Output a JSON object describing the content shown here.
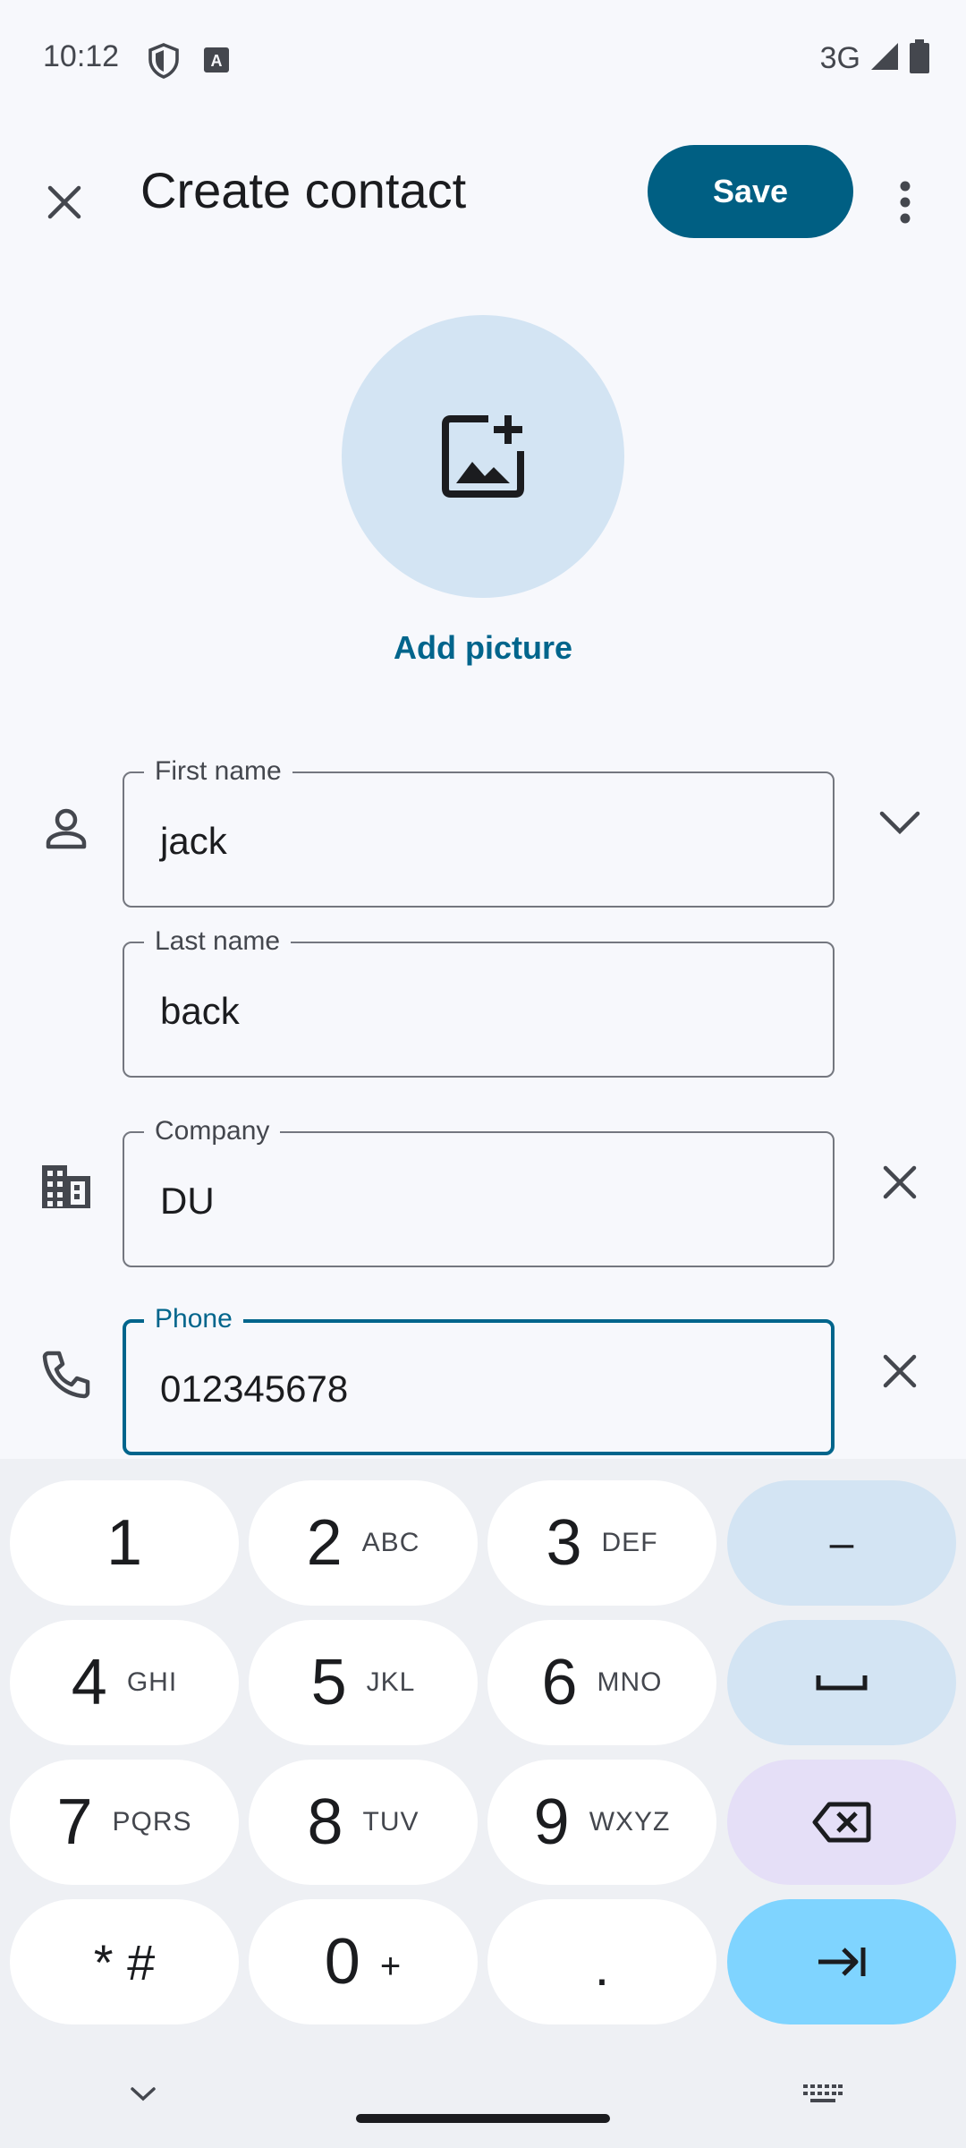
{
  "status_bar": {
    "time": "10:12",
    "network": "3G",
    "icons": [
      "shield-icon",
      "keyboard-a-icon",
      "signal-icon",
      "battery-icon"
    ]
  },
  "app_bar": {
    "title": "Create contact",
    "save_label": "Save",
    "icons": [
      "close-icon",
      "more-vert-icon"
    ]
  },
  "avatar": {
    "add_picture_label": "Add picture",
    "icon": "add-photo-icon"
  },
  "fields": {
    "first_name": {
      "label": "First name",
      "value": "jack"
    },
    "last_name": {
      "label": "Last name",
      "value": "back"
    },
    "company": {
      "label": "Company",
      "value": "DU"
    },
    "phone": {
      "label": "Phone",
      "value": "012345678"
    }
  },
  "keyboard": {
    "keys": [
      {
        "digit": "1",
        "letters": ""
      },
      {
        "digit": "2",
        "letters": "ABC"
      },
      {
        "digit": "3",
        "letters": "DEF"
      },
      {
        "digit": "4",
        "letters": "GHI"
      },
      {
        "digit": "5",
        "letters": "JKL"
      },
      {
        "digit": "6",
        "letters": "MNO"
      },
      {
        "digit": "7",
        "letters": "PQRS"
      },
      {
        "digit": "8",
        "letters": "TUV"
      },
      {
        "digit": "9",
        "letters": "WXYZ"
      },
      {
        "digit": "* #",
        "letters": ""
      },
      {
        "digit": "0",
        "letters": "+"
      },
      {
        "digit": ".",
        "letters": ""
      }
    ],
    "function_keys": {
      "minus": "–"
    }
  },
  "colors": {
    "accent": "#005f83",
    "avatar_bg": "#d3e4f3",
    "enter_key": "#7fd4ff",
    "backspace_key": "#e5dff7"
  }
}
